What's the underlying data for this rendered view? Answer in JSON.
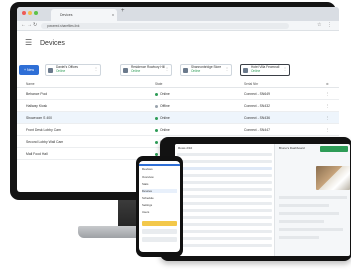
{
  "browser": {
    "tab_title": "Devices",
    "tab_close": "x",
    "new_tab": "+",
    "url": "powered.sharefiles.link",
    "traffic_colors": [
      "#ee5b56",
      "#f6be4f",
      "#5ec24a"
    ]
  },
  "app": {
    "title": "Devices",
    "menu_icon": "hamburger-icon",
    "new_button": "+ New",
    "filters": [
      {
        "name": "Daniel's Offices",
        "status": "Online"
      },
      {
        "name": "Residence Rowbury Hill",
        "status": "Online"
      },
      {
        "name": "Shannonbridge Store",
        "status": "Online"
      },
      {
        "name": "Hotel Villa Feomnall",
        "status": "Online"
      }
    ],
    "table": {
      "headers": [
        "Name",
        "State",
        "Serial Nbr"
      ],
      "rows": [
        {
          "name": "Behance Pool",
          "state": "Online",
          "serial": "Connect - SN649"
        },
        {
          "name": "Hallway Kiosk",
          "state": "Offline",
          "serial": "Connect - SN432"
        },
        {
          "name": "Showroom S 400",
          "state": "Online",
          "serial": "Connect - SN436",
          "selected": true
        },
        {
          "name": "Front Desk Lobby Cam",
          "state": "Online",
          "serial": "Connect - SN447"
        },
        {
          "name": "Second Lobby Wall Cam",
          "state": "Online",
          "serial": "Connect - SN448"
        },
        {
          "name": "Mall Food Hall",
          "state": "Online",
          "serial": "Connect - SN249"
        }
      ]
    }
  },
  "tablet": {
    "header": "Rows 2/10",
    "right_title": "Bruno's Dashboard"
  },
  "phone": {
    "header": "Devices",
    "items": [
      "Overview",
      "Stats",
      "Devices",
      "Schedule",
      "Settings",
      "Users"
    ]
  },
  "colors": {
    "accent": "#2f6fd6",
    "online": "#2e9c57"
  }
}
